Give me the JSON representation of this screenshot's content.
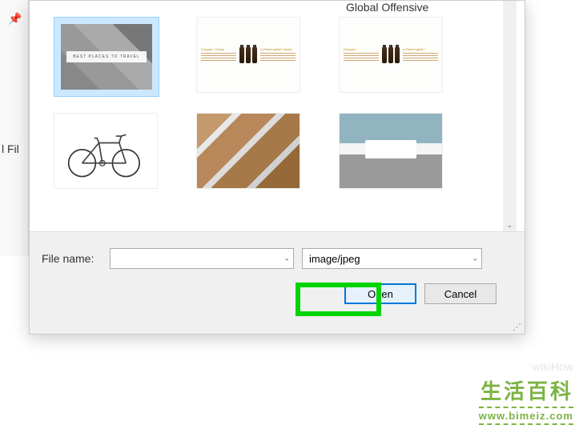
{
  "leftPane": {
    "truncatedLabel": "l Fil"
  },
  "header": {
    "caption": "Global Offensive"
  },
  "thumbnails": {
    "travel_banner": "BEST PLACES TO TRAVEL"
  },
  "filePanel": {
    "fileNameLabel": "File name:",
    "fileNameValue": "",
    "fileTypeValue": "image/jpeg",
    "openLabel": "Open",
    "cancelLabel": "Cancel"
  },
  "watermark": {
    "cn": "生活百科",
    "url": "www.bimeiz.com",
    "faint": "wikiHow"
  }
}
